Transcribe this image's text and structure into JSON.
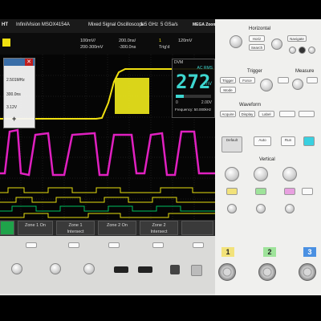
{
  "header": {
    "brand": "HT",
    "model": "InfiniiVision MSOX4154A",
    "description": "Mixed Signal Oscilloscope",
    "bandwidth": "1.5 GHz",
    "sample_rate": "5 GSa/s",
    "logo": "MEGA Zoom"
  },
  "settings": {
    "ch_volts": "100mV/",
    "range": "200-300mV",
    "timebase": "200.0ns/",
    "delay": "-300.0ns",
    "trig_ch": "1",
    "trig_level": "120mV",
    "trig_label": "Trig'd"
  },
  "popup": {
    "row1": "2.501MHz",
    "row2": "300.0ns",
    "row3": "3.12V",
    "plus": "+"
  },
  "dvm": {
    "title": "DVM",
    "mode": "AC RMS",
    "value": "272",
    "unit": "mV",
    "scale_min": "0",
    "scale_max": "2.00V",
    "frequency": "Frequency: 50.000kHz"
  },
  "softkeys": [
    {
      "line1": "",
      "line2": ""
    },
    {
      "line1": "Zone 1 On",
      "line2": ""
    },
    {
      "line1": "Zone 1",
      "line2": "Intersect"
    },
    {
      "line1": "Zone 2 On",
      "line2": ""
    },
    {
      "line1": "Zone 2",
      "line2": "Intersect"
    },
    {
      "line1": "",
      "line2": ""
    }
  ],
  "panel": {
    "horizontal": "Horizontal",
    "trigger": "Trigger",
    "measure": "Measure",
    "waveform": "Waveform",
    "vertical": "Vertical",
    "buttons_row1": [
      "Horiz",
      "Search",
      "Navigate"
    ],
    "buttons_row2": [
      "Trigger",
      "Force",
      "Mode"
    ],
    "buttons_row3": [
      "Acquire",
      "Display",
      "Label"
    ],
    "buttons_row4": [
      "Default",
      "Auto",
      "Run"
    ]
  },
  "channels": [
    "1",
    "2",
    "3"
  ],
  "colors": {
    "ch1": "#f0e010",
    "ch2": "#00c060",
    "ch3": "#e020c0",
    "digital": "#e8e010",
    "ch_badge1": "#f2e27a",
    "ch_badge2": "#9ee39a",
    "ch_badge3": "#4a90e2"
  }
}
